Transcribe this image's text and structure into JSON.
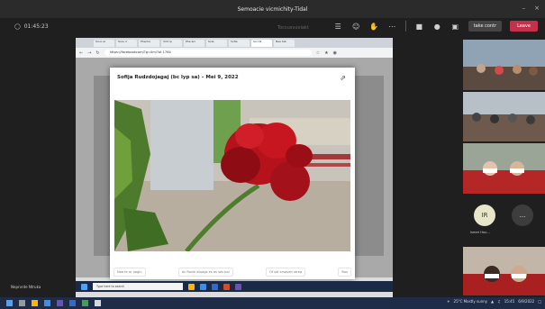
{
  "window": {
    "title": "Semoacie vicmichity-Tidal",
    "controls": [
      "–",
      "×"
    ]
  },
  "meeting": {
    "timer": "01:45:23",
    "faded_label": "Tocsusvuvlakt",
    "take_control_label": "take contr",
    "leave_label": "Leave"
  },
  "browser": {
    "tabs": [
      "Scuo ar",
      "Scou ir",
      "Phecha",
      "Vrkt ip",
      "Phe aix",
      "Sole",
      "Solte",
      "Sol 19",
      "Nee tab"
    ],
    "url": "https://facebookcom/?g=0m/?ot 1764"
  },
  "post": {
    "title": "Sofija Rudzdojagaj (bc lyp sa) – Mei 9, 2022",
    "footer": [
      "Nee fe or vogin",
      "Ac Rovik etuogs es as ses bal",
      "Of sid ersaveh strep",
      "Bos"
    ]
  },
  "inner_taskbar": {
    "search_placeholder": "Type here to search"
  },
  "participants": {
    "avatar1": {
      "initials": "IR",
      "name": "Ismet Hou..."
    },
    "avatar2": {
      "initials": "..."
    }
  },
  "left_note": "Neprvrde Ntruka",
  "tray": {
    "weather": "25°C Mostly sunny",
    "time": "15:45",
    "date": "6/9/2022"
  },
  "colors": {
    "teams_bg": "#1f1f1f",
    "leave_red": "#c4314b",
    "taskbar": "#1e2c47",
    "flower_red": "#b5121b"
  }
}
